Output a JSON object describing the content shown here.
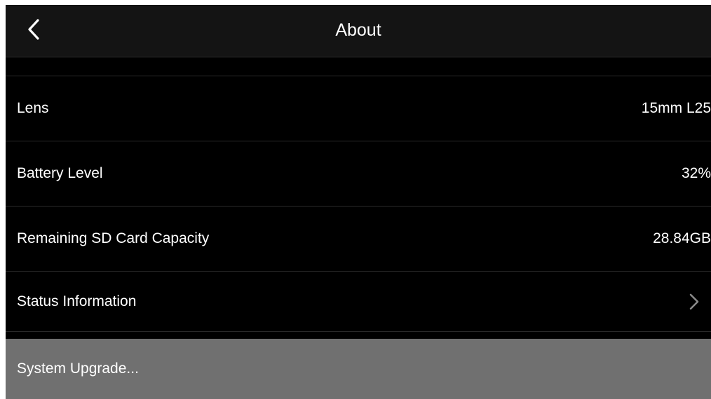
{
  "header": {
    "title": "About",
    "back_icon": "chevron-left-icon"
  },
  "rows": [
    {
      "label": "Lens",
      "value": "15mm L25"
    },
    {
      "label": "Battery Level",
      "value": "32%"
    },
    {
      "label": "Remaining SD Card Capacity",
      "value": "28.84GB"
    },
    {
      "label": "Status Information",
      "icon": "chevron-right-icon"
    }
  ],
  "system_upgrade": {
    "label": "System Upgrade..."
  },
  "colors": {
    "background": "#000000",
    "header_background": "#141414",
    "divider": "#2a2a2a",
    "text": "#ffffff",
    "upgrade_background": "#707070",
    "chevron": "#8a8a8a"
  }
}
